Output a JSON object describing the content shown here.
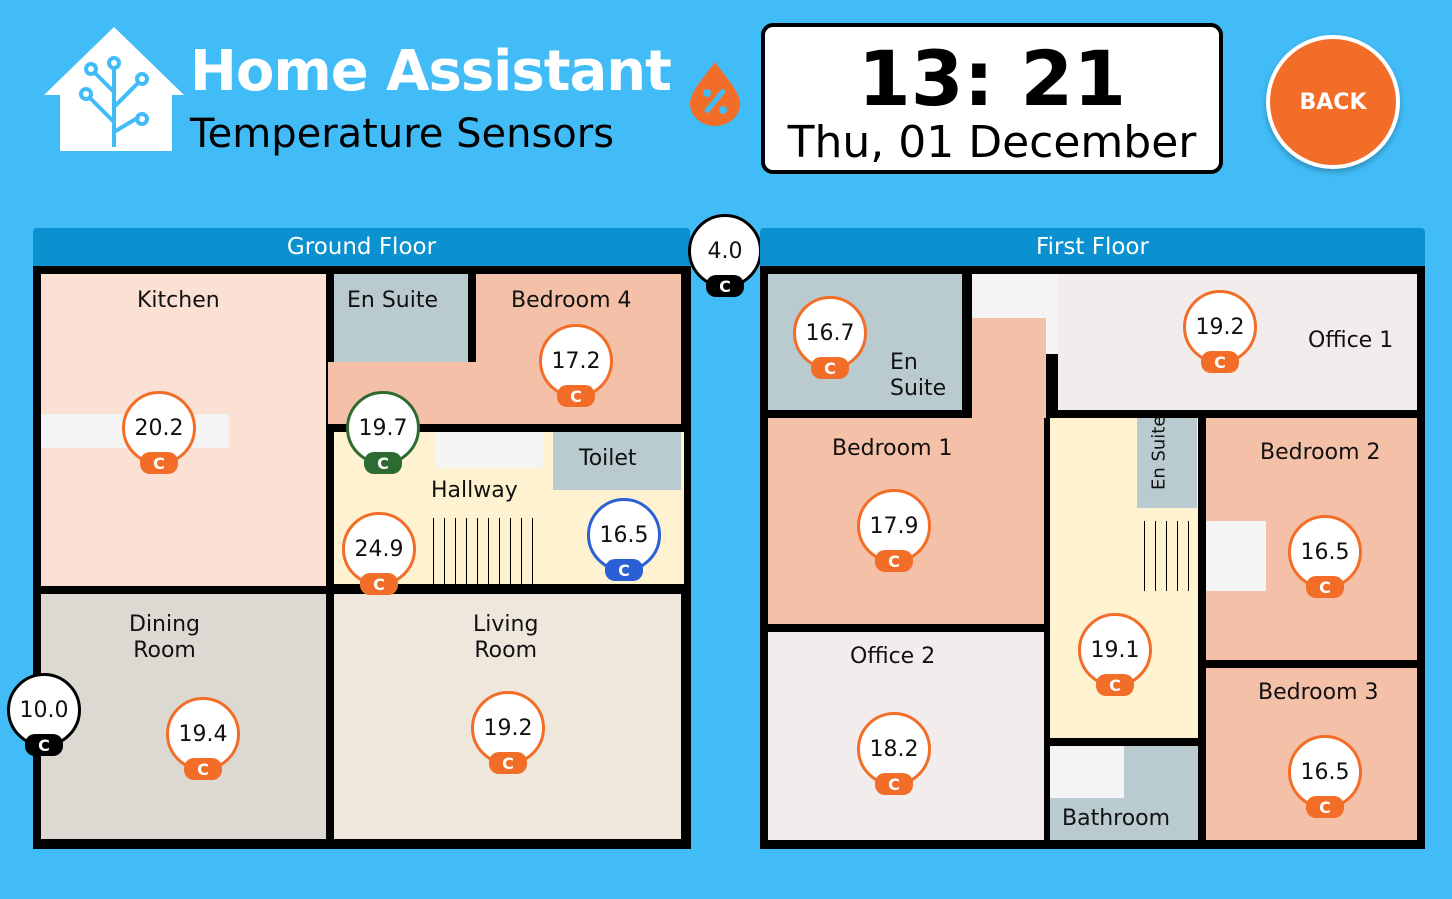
{
  "header": {
    "brand": "Home Assistant",
    "subtitle": "Temperature Sensors",
    "humidity_icon": "water-percent-icon",
    "logo_icon": "home-assistant-logo"
  },
  "clock": {
    "time": "13: 21",
    "date": "Thu, 01 December"
  },
  "back_button": {
    "label": "BACK"
  },
  "colors": {
    "background": "#41bcf6",
    "header_bar": "#0b91cf",
    "accent": "#f26e28",
    "sensor_green": "#2e6b33",
    "sensor_blue": "#2a5fd6"
  },
  "ground_floor": {
    "title": "Ground Floor",
    "rooms": {
      "kitchen": "Kitchen",
      "en_suite": "En Suite",
      "bedroom4": "Bedroom 4",
      "toilet": "Toilet",
      "hallway": "Hallway",
      "dining_line1": "Dining",
      "dining_line2": "Room",
      "living_line1": "Living",
      "living_line2": "Room"
    },
    "sensors": {
      "kitchen": {
        "value": "20.2",
        "unit": "C"
      },
      "bedroom4": {
        "value": "17.2",
        "unit": "C"
      },
      "hallway_upper": {
        "value": "19.7",
        "unit": "C"
      },
      "hallway_stairs": {
        "value": "24.9",
        "unit": "C"
      },
      "hallway_front": {
        "value": "16.5",
        "unit": "C"
      },
      "dining": {
        "value": "19.4",
        "unit": "C"
      },
      "living": {
        "value": "19.2",
        "unit": "C"
      },
      "outside_side": {
        "value": "10.0",
        "unit": "C"
      },
      "outside_top": {
        "value": "4.0",
        "unit": "C"
      }
    }
  },
  "first_floor": {
    "title": "First Floor",
    "rooms": {
      "en_suite_line1": "En",
      "en_suite_line2": "Suite",
      "office1": "Office 1",
      "bedroom1": "Bedroom 1",
      "en_suite2": "En Suite",
      "bedroom2": "Bedroom 2",
      "office2": "Office 2",
      "bedroom3": "Bedroom 3",
      "bathroom": "Bathroom"
    },
    "sensors": {
      "en_suite": {
        "value": "16.7",
        "unit": "C"
      },
      "office1": {
        "value": "19.2",
        "unit": "C"
      },
      "bedroom1": {
        "value": "17.9",
        "unit": "C"
      },
      "bedroom2": {
        "value": "16.5",
        "unit": "C"
      },
      "landing": {
        "value": "19.1",
        "unit": "C"
      },
      "office2": {
        "value": "18.2",
        "unit": "C"
      },
      "bedroom3": {
        "value": "16.5",
        "unit": "C"
      }
    }
  }
}
